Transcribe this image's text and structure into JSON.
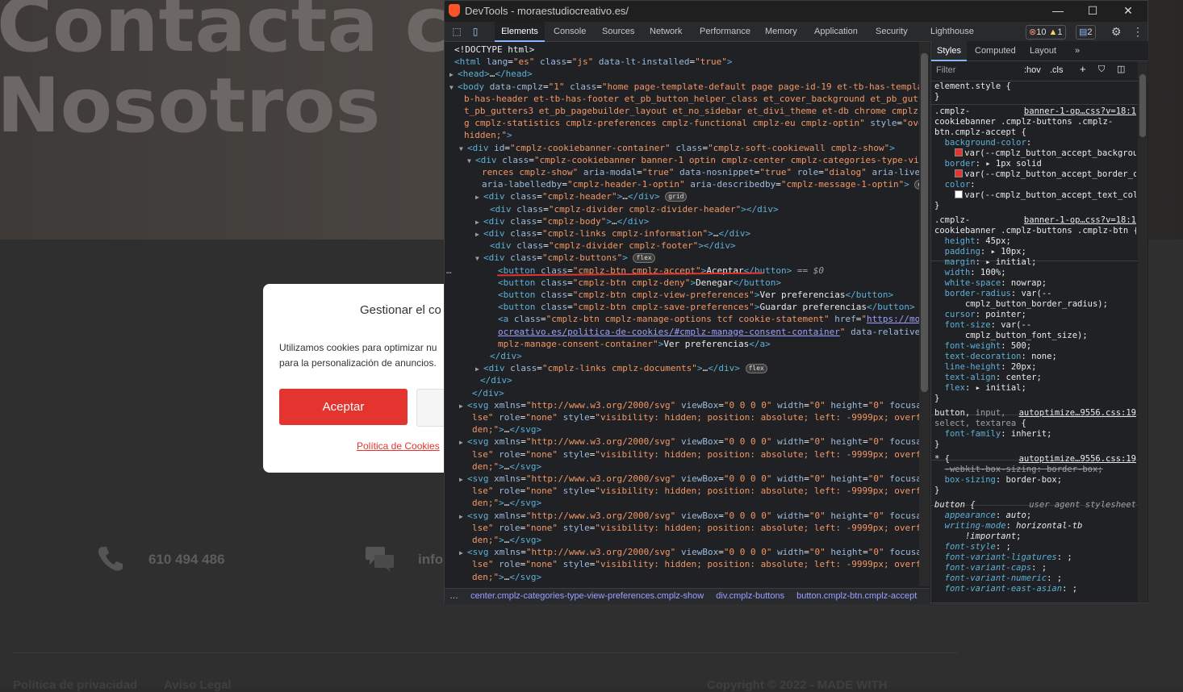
{
  "site": {
    "hero_line1": "Contacta con",
    "hero_line2": "Nosotros",
    "phone": "610 494 486",
    "email_partial": "info",
    "footer_privacy": "Política de privacidad",
    "footer_legal": "Aviso Legal",
    "footer_copyright": "Copyright © 2022 - MADE WITH"
  },
  "cookie": {
    "title": "Gestionar el co",
    "message_line1": "Utilizamos cookies para optimizar nu",
    "message_line2": "para la personalización de anuncios.",
    "accept_label": "Aceptar",
    "policy_link": "Política de Cookies"
  },
  "devtools": {
    "window_title": "DevTools - moraestudiocreativo.es/",
    "tabs": [
      "Elements",
      "Console",
      "Sources",
      "Network",
      "Performance",
      "Memory",
      "Application",
      "Security",
      "Lighthouse"
    ],
    "errors": "10",
    "warnings": "1",
    "messages": "2",
    "styles_tabs": [
      "Styles",
      "Computed",
      "Layout"
    ],
    "filter_placeholder": "Filter",
    "hov": ":hov",
    "cls": ".cls",
    "breadcrumb": [
      "center.cmplz-categories-type-view-preferences.cmplz-show",
      "div.cmplz-buttons",
      "button.cmplz-btn.cmplz-accept"
    ],
    "selected_eq": "== $0",
    "colors": {
      "accent": "#8ab4f8",
      "tag": "#5db0d7",
      "attr_value": "#f29766",
      "swatch_red": "#e3342f",
      "swatch_white": "#ffffff"
    }
  }
}
